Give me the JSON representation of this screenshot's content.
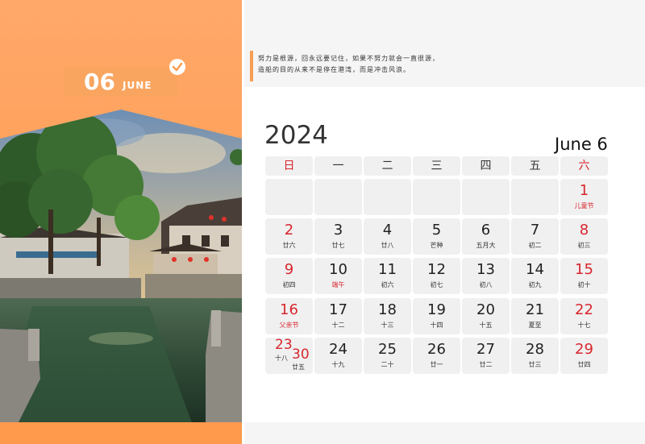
{
  "header": {
    "month_number": "06",
    "month_name": "JUNE",
    "quote_line1": "努力是根源，回永远要记住，如果不努力就会一直很源，",
    "quote_line2": "造船的目的从来不是停在港湾，而是冲击风浪。"
  },
  "calendar": {
    "year": "2024",
    "month_label": "June 6",
    "weekdays": [
      "日",
      "一",
      "二",
      "三",
      "四",
      "五",
      "六"
    ],
    "rows": [
      [
        {
          "day": "",
          "lunar": ""
        },
        {
          "day": "",
          "lunar": ""
        },
        {
          "day": "",
          "lunar": ""
        },
        {
          "day": "",
          "lunar": ""
        },
        {
          "day": "",
          "lunar": ""
        },
        {
          "day": "",
          "lunar": ""
        },
        {
          "day": "1",
          "lunar": "儿童节"
        }
      ],
      [
        {
          "day": "2",
          "lunar": "廿六"
        },
        {
          "day": "3",
          "lunar": "廿七"
        },
        {
          "day": "4",
          "lunar": "廿八"
        },
        {
          "day": "5",
          "lunar": "芒种"
        },
        {
          "day": "6",
          "lunar": "五月大"
        },
        {
          "day": "7",
          "lunar": "初二"
        },
        {
          "day": "8",
          "lunar": "初三"
        }
      ],
      [
        {
          "day": "9",
          "lunar": "初四"
        },
        {
          "day": "10",
          "lunar": "端午"
        },
        {
          "day": "11",
          "lunar": "初六"
        },
        {
          "day": "12",
          "lunar": "初七"
        },
        {
          "day": "13",
          "lunar": "初八"
        },
        {
          "day": "14",
          "lunar": "初九"
        },
        {
          "day": "15",
          "lunar": "初十"
        }
      ],
      [
        {
          "day": "16",
          "lunar": "父亲节"
        },
        {
          "day": "17",
          "lunar": "十二"
        },
        {
          "day": "18",
          "lunar": "十三"
        },
        {
          "day": "19",
          "lunar": "十四"
        },
        {
          "day": "20",
          "lunar": "十五"
        },
        {
          "day": "21",
          "lunar": "夏至"
        },
        {
          "day": "22",
          "lunar": "十七"
        }
      ],
      [
        {
          "day": "23",
          "lunar": "十八",
          "day2": "30",
          "lunar2": "廿五"
        },
        {
          "day": "24",
          "lunar": "十九"
        },
        {
          "day": "25",
          "lunar": "二十"
        },
        {
          "day": "26",
          "lunar": "廿一"
        },
        {
          "day": "27",
          "lunar": "廿二"
        },
        {
          "day": "28",
          "lunar": "廿三"
        },
        {
          "day": "29",
          "lunar": "廿四"
        }
      ]
    ]
  },
  "colors": {
    "accent_orange": "#ff9f55",
    "holiday_red": "#d8262e",
    "cell_gray": "#f0f0f0"
  }
}
